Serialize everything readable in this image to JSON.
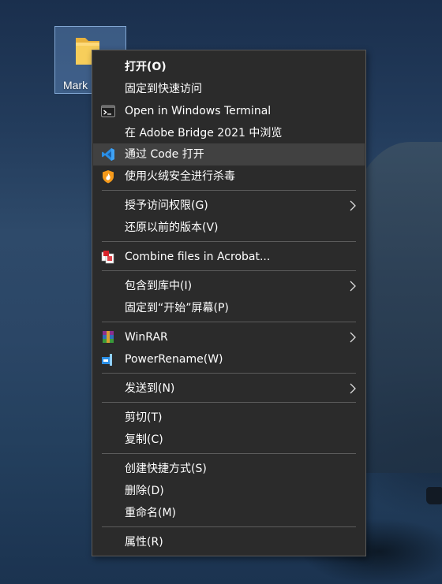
{
  "desktop": {
    "folder_label": "Mark"
  },
  "menu": {
    "items": [
      {
        "label": "打开(O)"
      },
      {
        "label": "固定到快速访问"
      },
      {
        "label": "Open in Windows Terminal",
        "icon": "terminal-icon"
      },
      {
        "label": "在 Adobe Bridge 2021 中浏览"
      },
      {
        "label": "通过 Code 打开",
        "icon": "vscode-icon"
      },
      {
        "label": "使用火绒安全进行杀毒",
        "icon": "huorong-shield-icon"
      },
      {
        "label": "授予访问权限(G)"
      },
      {
        "label": "还原以前的版本(V)"
      },
      {
        "label": "Combine files in Acrobat...",
        "icon": "acrobat-icon"
      },
      {
        "label": "包含到库中(I)"
      },
      {
        "label": "固定到“开始”屏幕(P)"
      },
      {
        "label": "WinRAR",
        "icon": "winrar-icon"
      },
      {
        "label": "PowerRename(W)",
        "icon": "powerrename-icon"
      },
      {
        "label": "发送到(N)"
      },
      {
        "label": "剪切(T)"
      },
      {
        "label": "复制(C)"
      },
      {
        "label": "创建快捷方式(S)"
      },
      {
        "label": "删除(D)"
      },
      {
        "label": "重命名(M)"
      },
      {
        "label": "属性(R)"
      }
    ]
  },
  "colors": {
    "menu_bg": "#2b2b2b",
    "menu_hover": "#414141",
    "separator": "#5c5c5c",
    "text": "#ffffff",
    "vscode_blue": "#2a8fe6",
    "huorong_orange": "#f59a1b",
    "acrobat_red": "#d8242b"
  }
}
